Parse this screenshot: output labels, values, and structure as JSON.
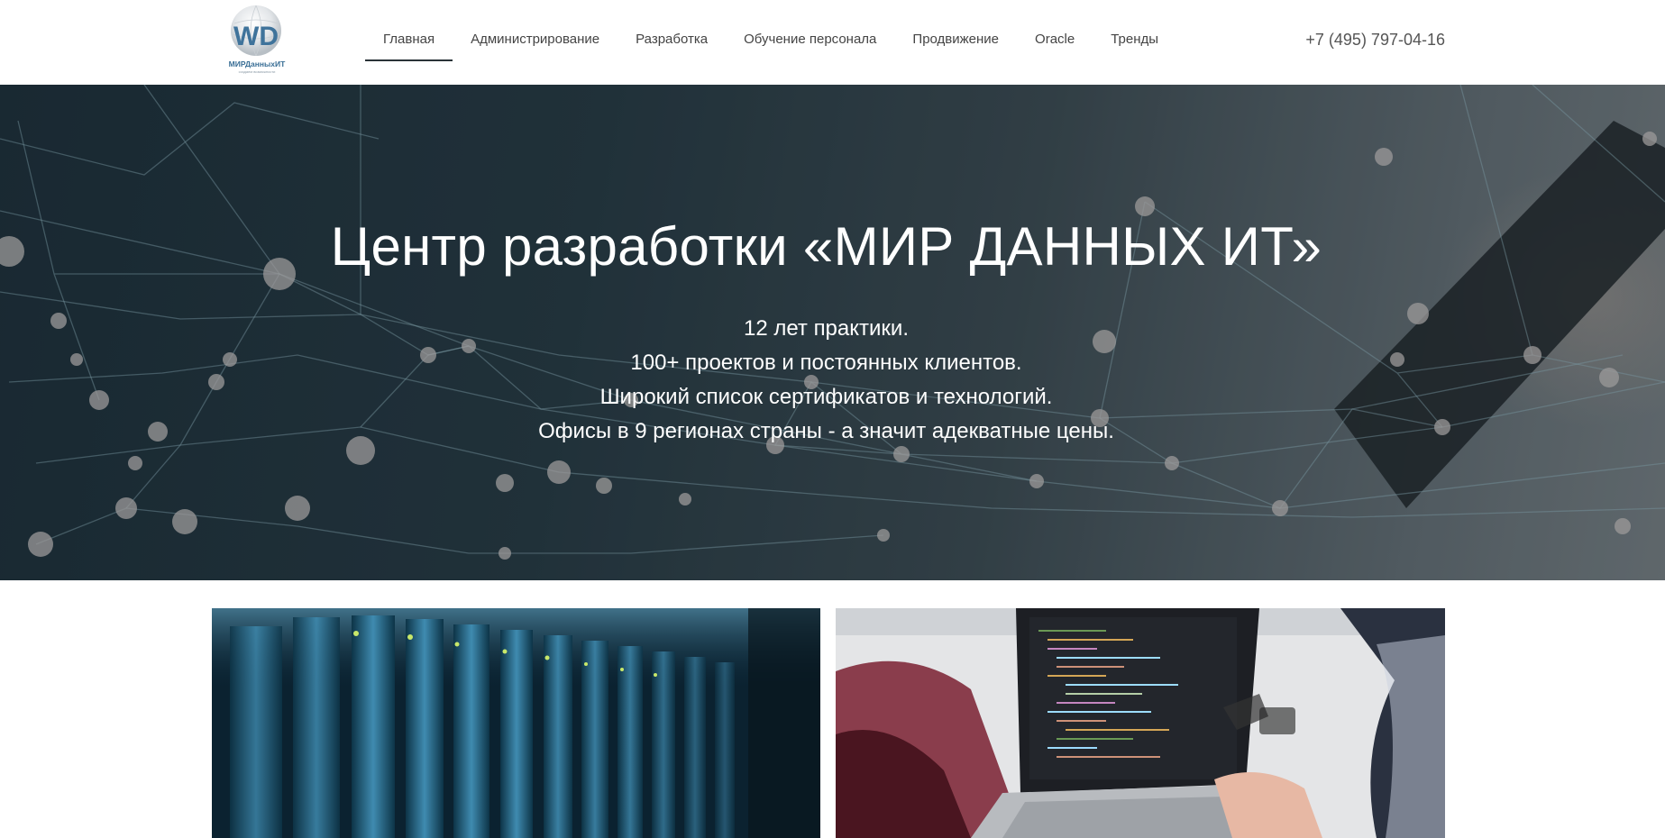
{
  "header": {
    "logo": {
      "monogram": "WD",
      "name": "МИРДанныхИТ",
      "tagline": "создаем возможности"
    },
    "nav": [
      {
        "label": "Главная",
        "active": true
      },
      {
        "label": "Администрирование",
        "active": false
      },
      {
        "label": "Разработка",
        "active": false
      },
      {
        "label": "Обучение персонала",
        "active": false
      },
      {
        "label": "Продвижение",
        "active": false
      },
      {
        "label": "Oracle",
        "active": false
      },
      {
        "label": "Тренды",
        "active": false
      }
    ],
    "phone": "+7 (495) 797-04-16"
  },
  "hero": {
    "title": "Центр разработки «МИР ДАННЫХ ИТ»",
    "lines": [
      "12 лет практики.",
      "100+ проектов и постоянных клиентов.",
      "Широкий список сертификатов и технологий.",
      "Офисы в 9 регионах страны - а значит адекватные цены."
    ]
  },
  "cards": [
    {
      "image": "server-rack-photo"
    },
    {
      "image": "laptop-code-photo"
    }
  ],
  "colors": {
    "nav_text": "#444444",
    "active_underline": "#2a3338",
    "hero_text": "#ffffff",
    "phone_text": "#555555",
    "logo_blue": "#3a6f96"
  }
}
